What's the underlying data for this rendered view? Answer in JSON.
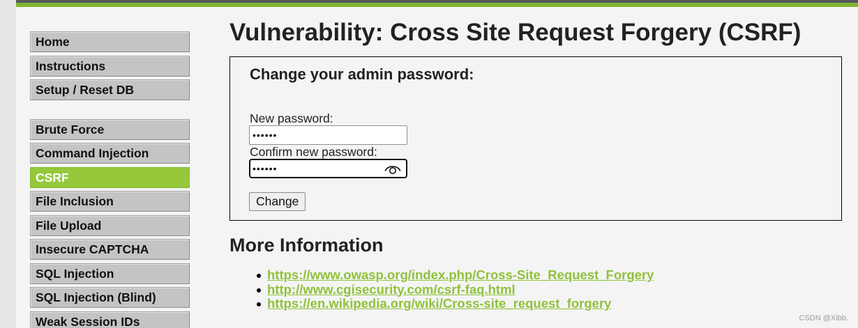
{
  "colors": {
    "accent_green": "#95c83a",
    "link_green": "#8fc23a",
    "menu_gray": "#c4c4c4",
    "header_dark": "#55595c"
  },
  "sidebar": {
    "groups": [
      {
        "items": [
          {
            "label": "Home",
            "selected": false
          },
          {
            "label": "Instructions",
            "selected": false
          },
          {
            "label": "Setup / Reset DB",
            "selected": false
          }
        ]
      },
      {
        "items": [
          {
            "label": "Brute Force",
            "selected": false
          },
          {
            "label": "Command Injection",
            "selected": false
          },
          {
            "label": "CSRF",
            "selected": true
          },
          {
            "label": "File Inclusion",
            "selected": false
          },
          {
            "label": "File Upload",
            "selected": false
          },
          {
            "label": "Insecure CAPTCHA",
            "selected": false
          },
          {
            "label": "SQL Injection",
            "selected": false
          },
          {
            "label": "SQL Injection (Blind)",
            "selected": false
          },
          {
            "label": "Weak Session IDs",
            "selected": false
          }
        ]
      }
    ]
  },
  "main": {
    "title": "Vulnerability: Cross Site Request Forgery (CSRF)",
    "form": {
      "heading": "Change your admin password:",
      "new_password_label": "New password:",
      "new_password_value": "••••••",
      "confirm_password_label": "Confirm new password:",
      "confirm_password_value": "••••••",
      "submit_label": "Change",
      "reveal_icon": "eye-icon"
    },
    "more_info": {
      "heading": "More Information",
      "links": [
        "https://www.owasp.org/index.php/Cross-Site_Request_Forgery",
        "http://www.cgisecurity.com/csrf-faq.html",
        "https://en.wikipedia.org/wiki/Cross-site_request_forgery"
      ]
    }
  },
  "watermark": "CSDN @Xibb."
}
